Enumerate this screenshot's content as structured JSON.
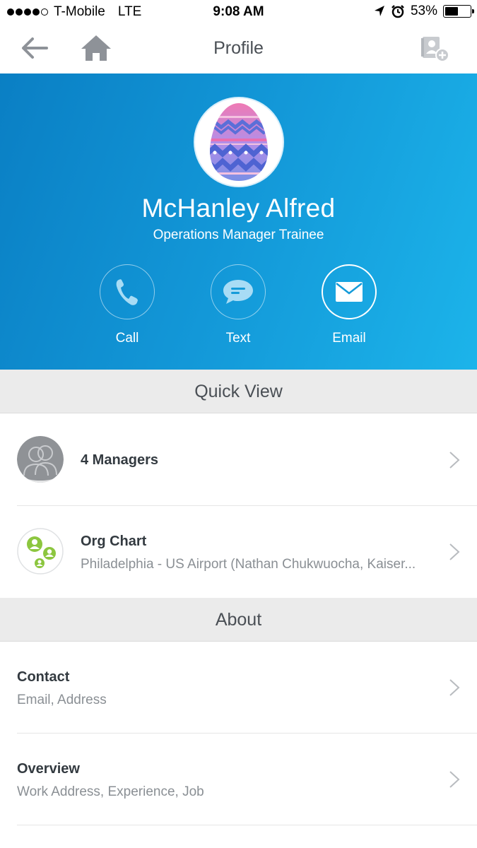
{
  "status_bar": {
    "carrier": "T-Mobile",
    "network": "LTE",
    "time": "9:08 AM",
    "battery": "53%",
    "battery_level": 0.53,
    "icons": [
      "signal-dots-icon",
      "location-arrow-icon",
      "alarm-icon",
      "battery-icon"
    ]
  },
  "nav": {
    "title": "Profile",
    "icons": [
      "back-arrow-icon",
      "home-icon",
      "add-contact-icon"
    ]
  },
  "profile": {
    "name": "McHanley Alfred",
    "job_title": "Operations Manager Trainee",
    "avatar": "easter-egg-avatar",
    "actions": [
      {
        "label": "Call",
        "icon": "phone-icon"
      },
      {
        "label": "Text",
        "icon": "chat-bubble-icon"
      },
      {
        "label": "Email",
        "icon": "envelope-icon"
      }
    ]
  },
  "quick_view": {
    "header": "Quick View",
    "items": [
      {
        "title": "4 Managers",
        "icon": "people-avatar-icon"
      },
      {
        "title": "Org Chart",
        "subtitle": "Philadelphia - US Airport (Nathan Chukwuocha, Kaiser...",
        "icon": "org-chart-icon"
      }
    ]
  },
  "about": {
    "header": "About",
    "items": [
      {
        "title": "Contact",
        "subtitle": "Email, Address"
      },
      {
        "title": "Overview",
        "subtitle": "Work Address, Experience, Job"
      }
    ]
  },
  "colors": {
    "hero_start": "#0a7fc4",
    "hero_end": "#1cb4ea",
    "section_bg": "#ebebeb",
    "org_chart_green": "#8cc63f"
  }
}
